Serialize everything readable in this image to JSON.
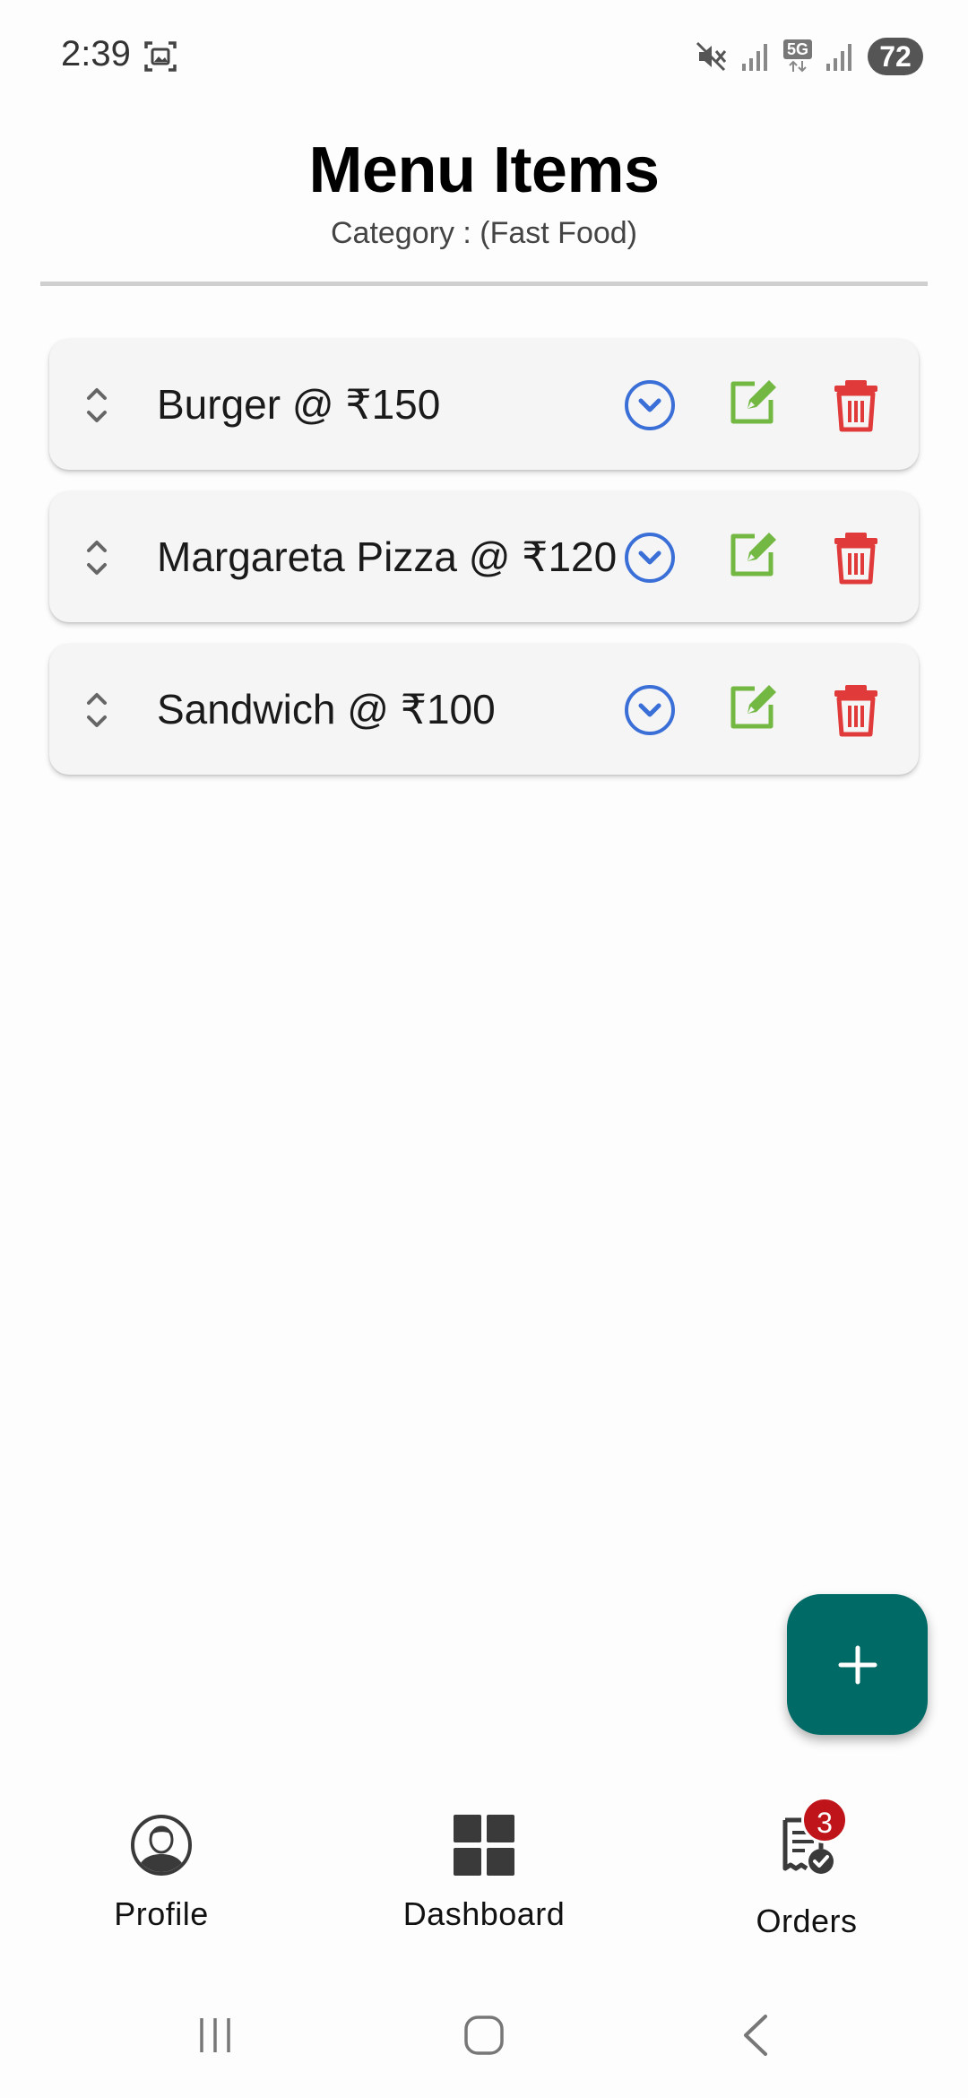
{
  "status_bar": {
    "time": "2:39",
    "network": "5G",
    "battery": "72"
  },
  "header": {
    "title": "Menu Items",
    "subtitle": "Category : (Fast Food)"
  },
  "menu_items": [
    {
      "label": "Burger @ ₹150"
    },
    {
      "label": "Margareta Pizza @ ₹120"
    },
    {
      "label": "Sandwich @ ₹100"
    }
  ],
  "colors": {
    "expand": "#3a6fd8",
    "edit": "#72b843",
    "delete": "#e03a3a",
    "fab": "#006b66",
    "badge": "#c0141b"
  },
  "bottom_nav": {
    "items": [
      {
        "label": "Profile",
        "icon": "profile-icon"
      },
      {
        "label": "Dashboard",
        "icon": "dashboard-icon"
      },
      {
        "label": "Orders",
        "icon": "orders-icon",
        "badge": "3"
      }
    ]
  },
  "fab": {
    "icon": "plus-icon"
  }
}
